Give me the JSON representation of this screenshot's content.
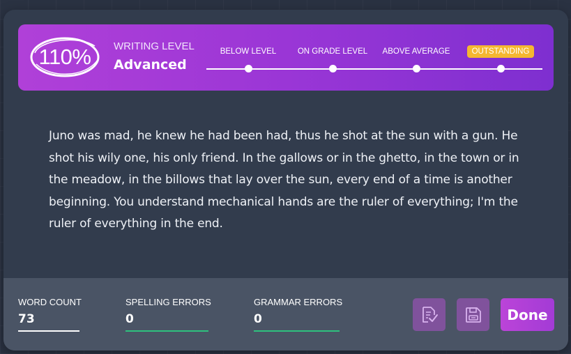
{
  "colors": {
    "banner_gradient_start": "#b040d8",
    "banner_gradient_end": "#7e2fd0",
    "active_level_badge": "#f5b731",
    "card_background": "#323c4d",
    "footer_background": "#4a5465",
    "error_underline": "#2ec27e",
    "word_count_underline": "#ffffff",
    "icon_button": "#80529c",
    "done_button": "#bb44d8"
  },
  "writing_level": {
    "score": "110%",
    "caption": "WRITING LEVEL",
    "name": "Advanced",
    "stops": [
      {
        "label": "BELOW LEVEL",
        "active": false
      },
      {
        "label": "ON GRADE LEVEL",
        "active": false
      },
      {
        "label": "ABOVE AVERAGE",
        "active": false
      },
      {
        "label": "OUTSTANDING",
        "active": true
      }
    ]
  },
  "essay": {
    "text": "Juno was mad, he knew he had been had, thus he shot at the sun with a gun. He shot his wily one, his only friend. In the gallows or in the ghetto, in the town or in the meadow, in the billows that lay over the sun, every end of a time is another beginning. You understand mechanical hands are the ruler of everything; I'm the ruler of everything in the end."
  },
  "stats": {
    "word_count": {
      "label": "WORD COUNT",
      "value": "73"
    },
    "spelling_errors": {
      "label": "SPELLING ERRORS",
      "value": "0"
    },
    "grammar_errors": {
      "label": "GRAMMAR ERRORS",
      "value": "0"
    }
  },
  "actions": {
    "review_icon": "document-check-icon",
    "save_icon": "save-disk-icon",
    "done_label": "Done"
  }
}
